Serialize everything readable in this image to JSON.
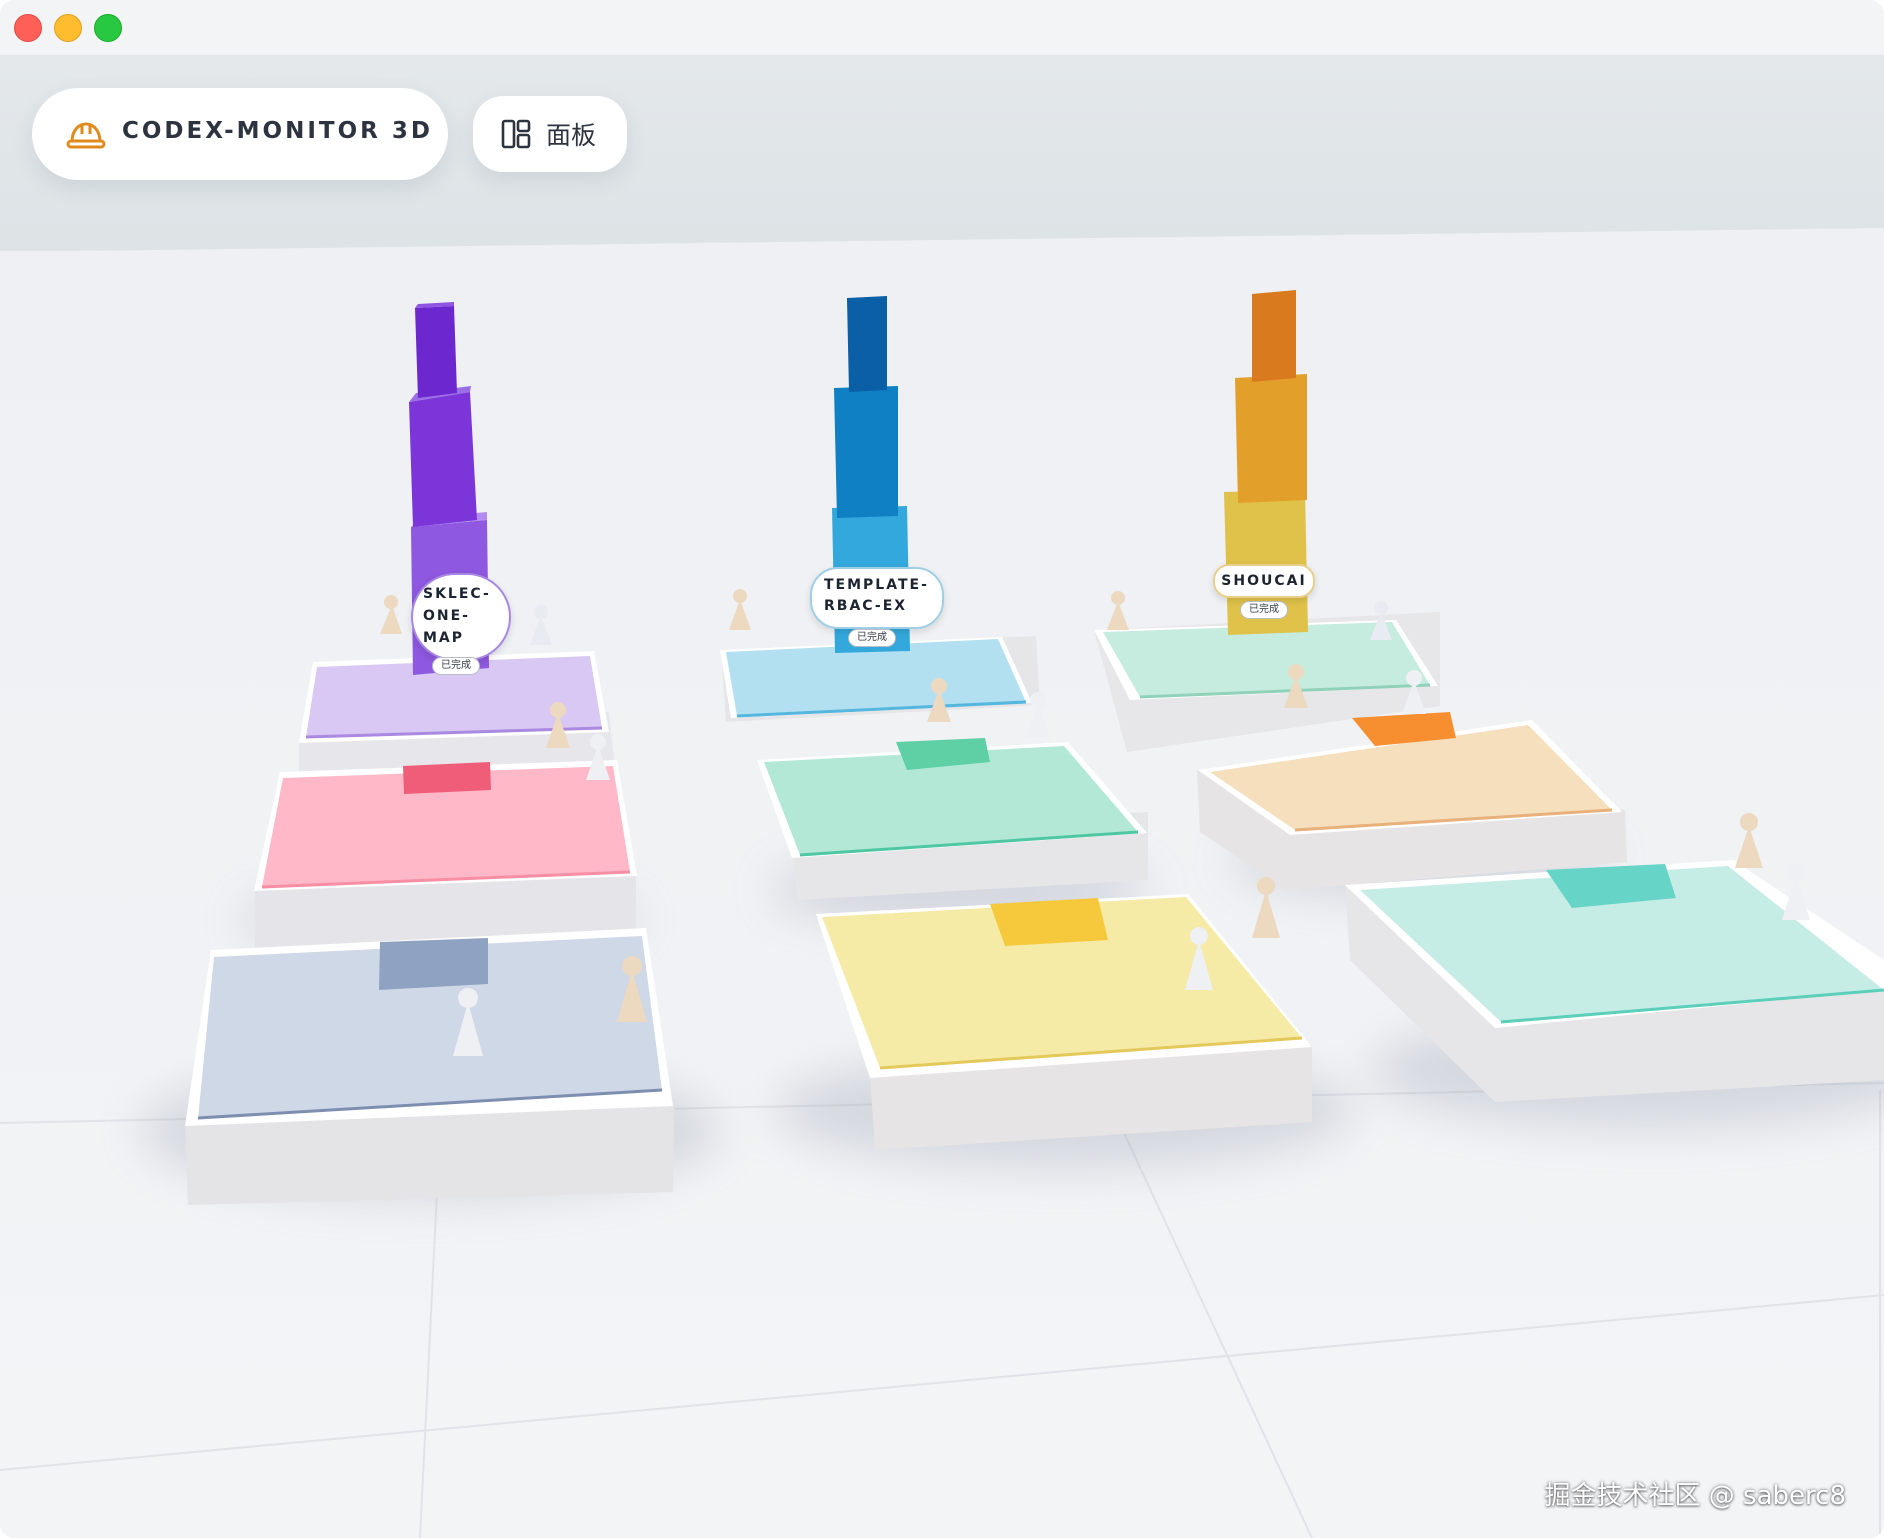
{
  "window": {
    "controls": [
      "close",
      "minimize",
      "zoom"
    ]
  },
  "toolbar": {
    "brand_icon": "hard-hat-icon",
    "brand_title": "CODEX-MONITOR 3D",
    "panel_icon": "dashboard-layout-icon",
    "panel_label": "面板"
  },
  "projects": [
    {
      "name": "SKLEC-\nONE-\nMAP",
      "status": "已完成",
      "color": "#7b35d8"
    },
    {
      "name": "TEMPLATE-\nRBAC-EX",
      "status": "已完成",
      "color": "#0f80c4"
    },
    {
      "name": "SHOUCAI",
      "status": "已完成",
      "color": "#e2a02a"
    }
  ],
  "zone_colors": {
    "purple": "#d8c8f3",
    "blue": "#b3e0f1",
    "mint": "#c6ecdf",
    "pink": "#ffb8c7",
    "green": "#b2e8d5",
    "peach": "#f6dfbd",
    "slate": "#cfd8e6",
    "yellow": "#f5eaa6",
    "teal": "#c6ece6"
  },
  "watermark": "掘金技术社区 @ saberc8"
}
